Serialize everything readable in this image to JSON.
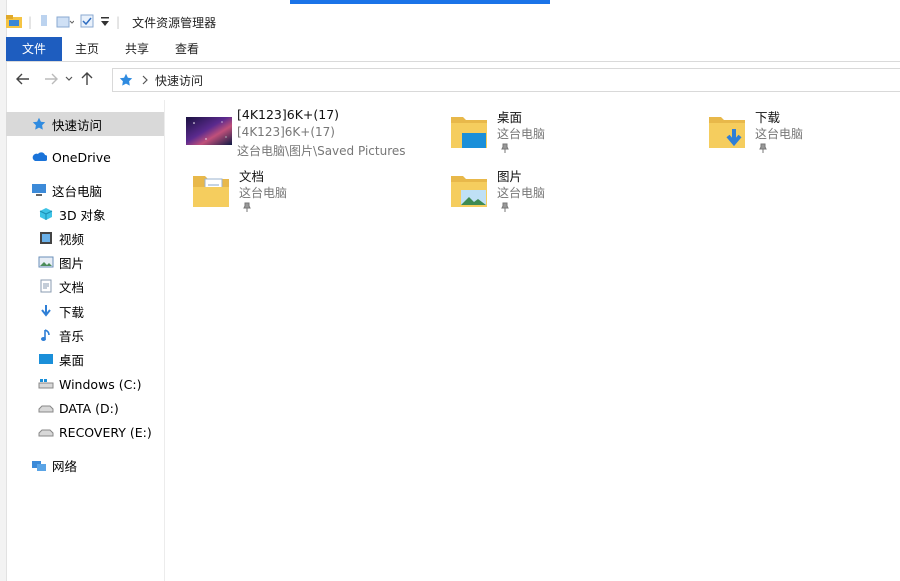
{
  "window": {
    "title": "文件资源管理器"
  },
  "ribbon": {
    "tabs": [
      "文件",
      "主页",
      "共享",
      "查看"
    ]
  },
  "address": {
    "path": "快速访问"
  },
  "sidebar": {
    "items": [
      {
        "label": "快速访问",
        "icon": "star-icon"
      },
      {
        "label": "OneDrive",
        "icon": "cloud-icon"
      },
      {
        "label": "这台电脑",
        "icon": "computer-icon"
      },
      {
        "label": "3D 对象",
        "icon": "cube-icon"
      },
      {
        "label": "视频",
        "icon": "video-icon"
      },
      {
        "label": "图片",
        "icon": "picture-icon"
      },
      {
        "label": "文档",
        "icon": "document-icon"
      },
      {
        "label": "下载",
        "icon": "download-icon"
      },
      {
        "label": "音乐",
        "icon": "music-icon"
      },
      {
        "label": "桌面",
        "icon": "desktop-icon"
      },
      {
        "label": "Windows (C:)",
        "icon": "drive-icon"
      },
      {
        "label": "DATA (D:)",
        "icon": "drive-icon"
      },
      {
        "label": "RECOVERY (E:)",
        "icon": "drive-icon"
      },
      {
        "label": "网络",
        "icon": "network-icon"
      }
    ]
  },
  "content": {
    "recent_file": {
      "name": "[4K123]6K+(17)",
      "sub": "[4K123]6K+(17)",
      "path": "这台电脑\\图片\\Saved Pictures"
    },
    "folders": [
      {
        "name": "桌面",
        "location": "这台电脑"
      },
      {
        "name": "下载",
        "location": "这台电脑"
      },
      {
        "name": "文档",
        "location": "这台电脑"
      },
      {
        "name": "图片",
        "location": "这台电脑"
      }
    ]
  },
  "colors": {
    "accent": "#1e5dbf",
    "selected": "#d9d9d9",
    "folder": "#f5c443"
  }
}
